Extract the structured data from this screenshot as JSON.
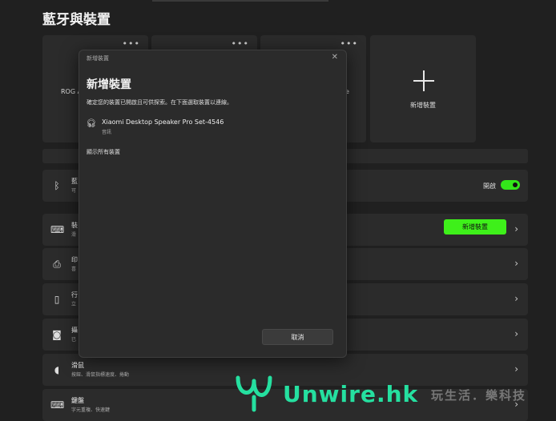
{
  "page": {
    "title": "藍牙與裝置"
  },
  "cards": [
    {
      "label": "ROG A"
    },
    {
      "label": ""
    },
    {
      "label": "e"
    },
    {
      "label": "新增裝置"
    }
  ],
  "rows": [
    {
      "title": "藍",
      "subtitle": "可",
      "toggle_label": "開啟",
      "toggle_on": true
    },
    {
      "title": "裝",
      "subtitle": "滑",
      "button": "新增裝置"
    },
    {
      "title": "印",
      "subtitle": "喜"
    },
    {
      "title": "行",
      "subtitle": "立"
    },
    {
      "title": "攝",
      "subtitle": "已"
    },
    {
      "title": "滑鼠",
      "subtitle": "按鈕、滑鼠指標速度、捲動"
    },
    {
      "title": "鍵盤",
      "subtitle": "字元重複、快速鍵"
    }
  ],
  "dialog": {
    "titlebar": "新增裝置",
    "close": "✕",
    "heading": "新增裝置",
    "description": "確定您的裝置已開啟且可供探索。在下面選取裝置以連線。",
    "devices": [
      {
        "name": "Xiaomi Desktop Speaker Pro Set-4546",
        "type": "音訊",
        "icon": "headset-icon"
      }
    ],
    "show_all": "顯示所有裝置",
    "cancel": "取消"
  },
  "watermark": {
    "brand": "Unwire",
    "tld": ".hk",
    "slogan": "玩生活．樂科技"
  },
  "colors": {
    "accent": "#3ef01a",
    "background": "#202020",
    "surface": "#2b2b2b",
    "watermark": "#25e0a0"
  }
}
